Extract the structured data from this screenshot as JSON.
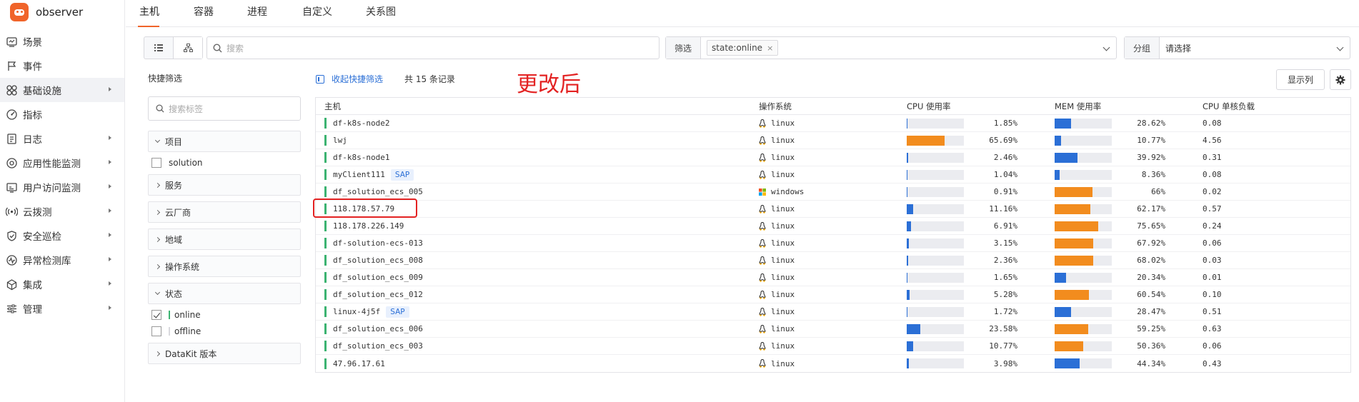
{
  "app": {
    "name": "observer"
  },
  "sidebar": {
    "items": [
      {
        "label": "场景",
        "icon": "scene-icon",
        "caret": false,
        "active": false
      },
      {
        "label": "事件",
        "icon": "flag-icon",
        "caret": false,
        "active": false
      },
      {
        "label": "基础设施",
        "icon": "infrastructure-icon",
        "caret": true,
        "active": true
      },
      {
        "label": "指标",
        "icon": "metric-icon",
        "caret": false,
        "active": false
      },
      {
        "label": "日志",
        "icon": "log-icon",
        "caret": true,
        "active": false
      },
      {
        "label": "应用性能监测",
        "icon": "apm-icon",
        "caret": true,
        "active": false
      },
      {
        "label": "用户访问监测",
        "icon": "rum-icon",
        "caret": true,
        "active": false
      },
      {
        "label": "云拨测",
        "icon": "dial-icon",
        "caret": true,
        "active": false
      },
      {
        "label": "安全巡检",
        "icon": "shield-icon",
        "caret": true,
        "active": false
      },
      {
        "label": "异常检测库",
        "icon": "anomaly-icon",
        "caret": true,
        "active": false
      },
      {
        "label": "集成",
        "icon": "integration-icon",
        "caret": true,
        "active": false
      },
      {
        "label": "管理",
        "icon": "settings-sliders-icon",
        "caret": true,
        "active": false
      }
    ]
  },
  "tabs": [
    {
      "label": "主机",
      "active": true
    },
    {
      "label": "容器",
      "active": false
    },
    {
      "label": "进程",
      "active": false
    },
    {
      "label": "自定义",
      "active": false
    },
    {
      "label": "关系图",
      "active": false
    }
  ],
  "toolbar": {
    "search_placeholder": "搜索",
    "filter_label": "筛选",
    "filter_tag": "state:online",
    "filter_tag_close": "×",
    "group_label": "分组",
    "group_value": "请选择"
  },
  "quick_filter": {
    "title": "快捷筛选",
    "search_placeholder": "搜索标签",
    "facets": [
      {
        "label": "项目",
        "expanded": true,
        "options": [
          {
            "label": "solution",
            "checked": false,
            "color": ""
          }
        ]
      },
      {
        "label": "服务",
        "expanded": false,
        "options": []
      },
      {
        "label": "云厂商",
        "expanded": false,
        "options": []
      },
      {
        "label": "地域",
        "expanded": false,
        "options": []
      },
      {
        "label": "操作系统",
        "expanded": false,
        "options": []
      },
      {
        "label": "状态",
        "expanded": true,
        "options": [
          {
            "label": "online",
            "checked": true,
            "color": "#3cb371"
          },
          {
            "label": "offline",
            "checked": false,
            "color": "#d9d9de"
          }
        ]
      },
      {
        "label": "DataKit 版本",
        "expanded": false,
        "options": []
      }
    ]
  },
  "list": {
    "collapse_label": "收起快捷筛选",
    "record_count": "共 15 条记录",
    "annotation": "更改后",
    "columns_button": "显示列",
    "columns": [
      "主机",
      "操作系统",
      "CPU 使用率",
      "MEM 使用率",
      "CPU 单核负载"
    ],
    "colors": {
      "low": "#2b6fd6",
      "high": "#f28c1e",
      "status": "#3cb371"
    },
    "rows": [
      {
        "host": "df-k8s-node2",
        "sap": "",
        "os": "linux",
        "cpu": "1.85%",
        "cpu_v": 1.85,
        "mem": "28.62%",
        "mem_v": 28.62,
        "load": "0.08"
      },
      {
        "host": "lwj",
        "sap": "",
        "os": "linux",
        "cpu": "65.69%",
        "cpu_v": 65.69,
        "mem": "10.77%",
        "mem_v": 10.77,
        "load": "4.56"
      },
      {
        "host": "df-k8s-node1",
        "sap": "",
        "os": "linux",
        "cpu": "2.46%",
        "cpu_v": 2.46,
        "mem": "39.92%",
        "mem_v": 39.92,
        "load": "0.31"
      },
      {
        "host": "myClient111",
        "sap": "SAP",
        "os": "linux",
        "cpu": "1.04%",
        "cpu_v": 1.04,
        "mem": "8.36%",
        "mem_v": 8.36,
        "load": "0.08"
      },
      {
        "host": "df_solution_ecs_005",
        "sap": "",
        "os": "windows",
        "cpu": "0.91%",
        "cpu_v": 0.91,
        "mem": "66%",
        "mem_v": 66,
        "load": "0.02"
      },
      {
        "host": "118.178.57.79",
        "sap": "",
        "os": "linux",
        "cpu": "11.16%",
        "cpu_v": 11.16,
        "mem": "62.17%",
        "mem_v": 62.17,
        "load": "0.57"
      },
      {
        "host": "118.178.226.149",
        "sap": "",
        "os": "linux",
        "cpu": "6.91%",
        "cpu_v": 6.91,
        "mem": "75.65%",
        "mem_v": 75.65,
        "load": "0.24"
      },
      {
        "host": "df-solution-ecs-013",
        "sap": "",
        "os": "linux",
        "cpu": "3.15%",
        "cpu_v": 3.15,
        "mem": "67.92%",
        "mem_v": 67.92,
        "load": "0.06"
      },
      {
        "host": "df_solution_ecs_008",
        "sap": "",
        "os": "linux",
        "cpu": "2.36%",
        "cpu_v": 2.36,
        "mem": "68.02%",
        "mem_v": 68.02,
        "load": "0.03"
      },
      {
        "host": "df_solution_ecs_009",
        "sap": "",
        "os": "linux",
        "cpu": "1.65%",
        "cpu_v": 1.65,
        "mem": "20.34%",
        "mem_v": 20.34,
        "load": "0.01"
      },
      {
        "host": "df_solution_ecs_012",
        "sap": "",
        "os": "linux",
        "cpu": "5.28%",
        "cpu_v": 5.28,
        "mem": "60.54%",
        "mem_v": 60.54,
        "load": "0.10"
      },
      {
        "host": "linux-4j5f",
        "sap": "SAP",
        "os": "linux",
        "cpu": "1.72%",
        "cpu_v": 1.72,
        "mem": "28.47%",
        "mem_v": 28.47,
        "load": "0.51"
      },
      {
        "host": "df_solution_ecs_006",
        "sap": "",
        "os": "linux",
        "cpu": "23.58%",
        "cpu_v": 23.58,
        "mem": "59.25%",
        "mem_v": 59.25,
        "load": "0.63"
      },
      {
        "host": "df_solution_ecs_003",
        "sap": "",
        "os": "linux",
        "cpu": "10.77%",
        "cpu_v": 10.77,
        "mem": "50.36%",
        "mem_v": 50.36,
        "load": "0.06"
      },
      {
        "host": "47.96.17.61",
        "sap": "",
        "os": "linux",
        "cpu": "3.98%",
        "cpu_v": 3.98,
        "mem": "44.34%",
        "mem_v": 44.34,
        "load": "0.43"
      }
    ]
  }
}
